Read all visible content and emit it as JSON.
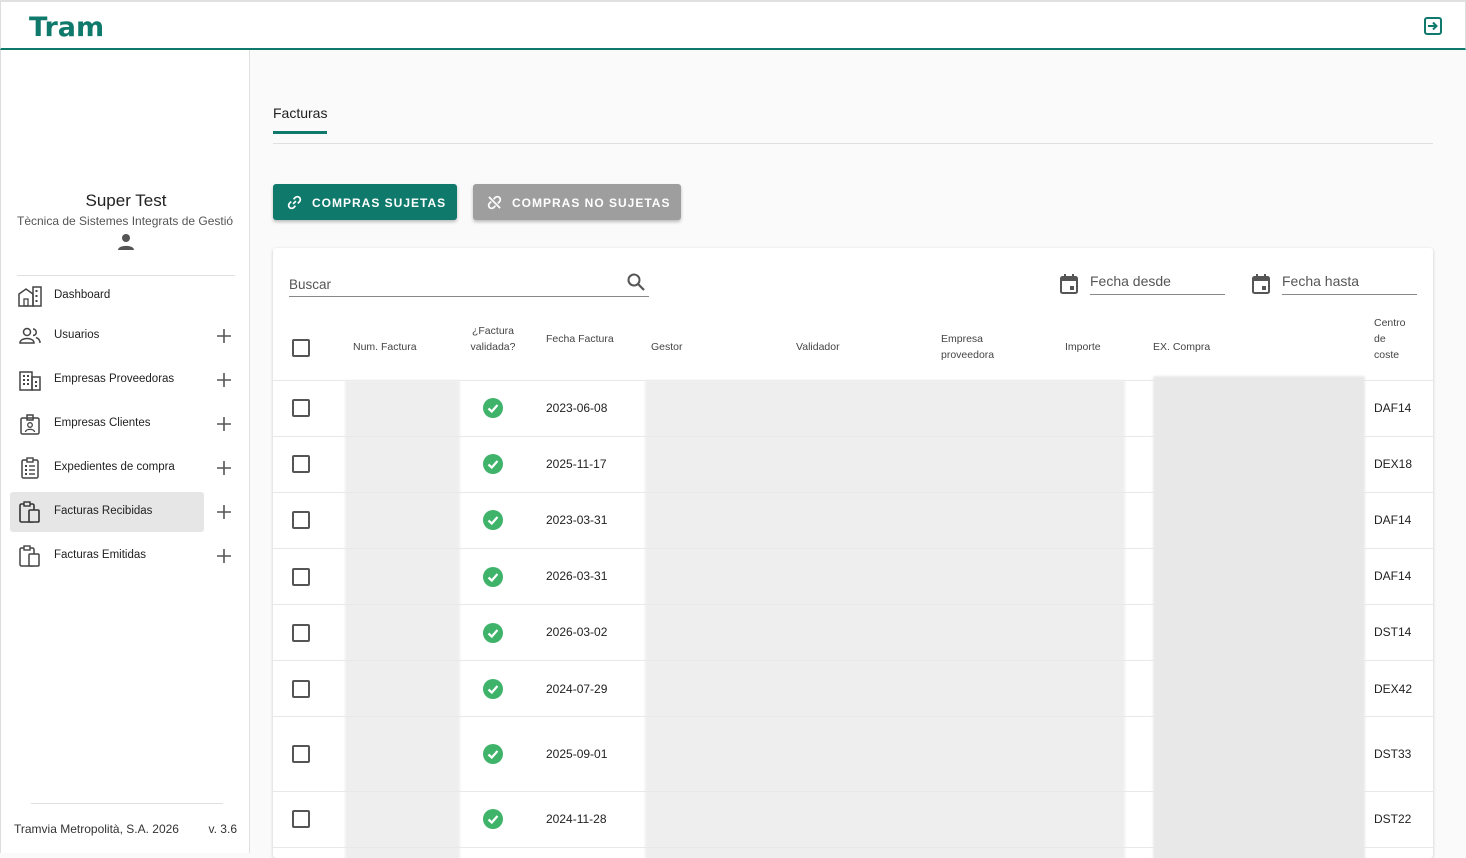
{
  "app": {
    "logo": "Tram"
  },
  "user": {
    "name": "Super Test",
    "role": "Tècnica de Sistemes Integrats de Gestió"
  },
  "nav": [
    {
      "label": "Dashboard",
      "icon": "dashboard-icon",
      "expandable": false,
      "active": false
    },
    {
      "label": "Usuarios",
      "icon": "users-icon",
      "expandable": true,
      "active": false
    },
    {
      "label": "Empresas Proveedoras",
      "icon": "building-icon",
      "expandable": true,
      "active": false
    },
    {
      "label": "Empresas Clientes",
      "icon": "badge-icon",
      "expandable": true,
      "active": false
    },
    {
      "label": "Expedientes de compra",
      "icon": "clipboard-list-icon",
      "expandable": true,
      "active": false
    },
    {
      "label": "Facturas Recibidas",
      "icon": "clipboard-copy-icon",
      "expandable": true,
      "active": true
    },
    {
      "label": "Facturas Emitidas",
      "icon": "clipboard-copy-icon",
      "expandable": true,
      "active": false
    }
  ],
  "footer": {
    "company": "Tramvia Metropolità, S.A. 2026",
    "version": "v. 3.6"
  },
  "tabs": [
    {
      "label": "Facturas",
      "active": true
    }
  ],
  "buttons": {
    "subject": "COMPRAS SUJETAS",
    "not_subject": "COMPRAS NO SUJETAS"
  },
  "filters": {
    "search_placeholder": "Buscar",
    "date_from": "Fecha desde",
    "date_to": "Fecha hasta"
  },
  "table": {
    "headers": {
      "num": "Num. Factura",
      "validated_1": "¿Factura",
      "validated_2": "validada?",
      "date": "Fecha Factura",
      "manager": "Gestor",
      "validator": "Validador",
      "supplier_1": "Empresa",
      "supplier_2": "proveedora",
      "amount": "Importe",
      "purchase": "EX. Compra",
      "cost_1": "Centro",
      "cost_2": "de",
      "cost_3": "coste"
    },
    "rows": [
      {
        "date": "2023-06-08",
        "validated": true,
        "cost_center": "DAF14"
      },
      {
        "date": "2025-11-17",
        "validated": true,
        "cost_center": "DEX18"
      },
      {
        "date": "2023-03-31",
        "validated": true,
        "cost_center": "DAF14"
      },
      {
        "date": "2026-03-31",
        "validated": true,
        "cost_center": "DAF14"
      },
      {
        "date": "2026-03-02",
        "validated": true,
        "cost_center": "DST14"
      },
      {
        "date": "2024-07-29",
        "validated": true,
        "cost_center": "DEX42"
      },
      {
        "date": "2025-09-01",
        "validated": true,
        "cost_center": "DST33"
      },
      {
        "date": "2024-11-28",
        "validated": true,
        "cost_center": "DST22"
      }
    ]
  },
  "colors": {
    "accent": "#0f7a6c",
    "disabled": "#9e9e9e",
    "success": "#3fb36a"
  }
}
